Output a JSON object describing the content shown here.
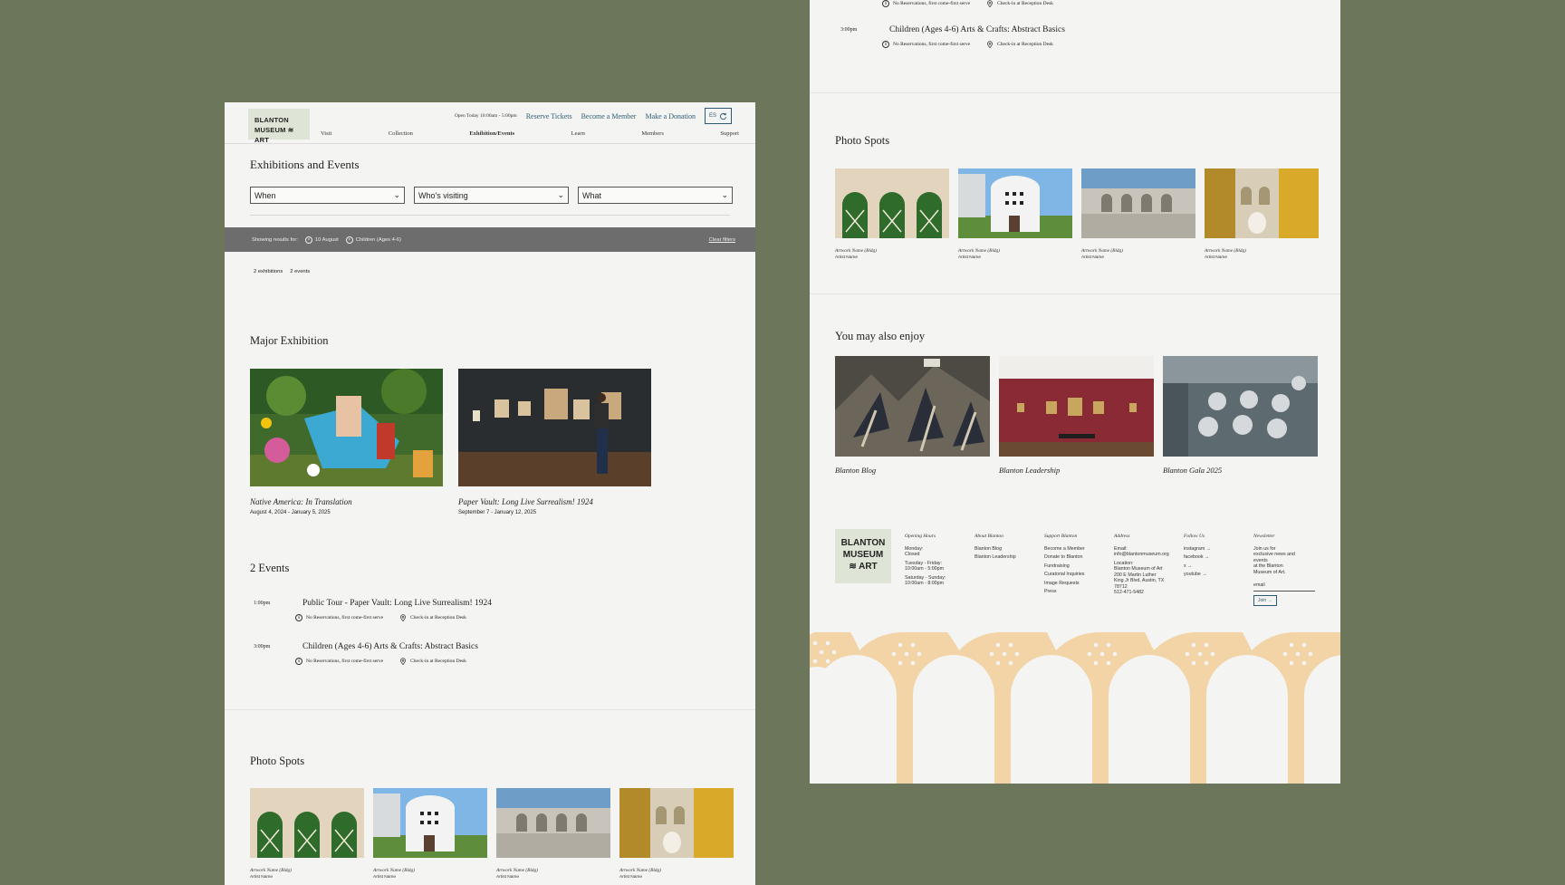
{
  "header": {
    "logo_line1": "BLANTON",
    "logo_line2": "MUSEUM ≋ ART",
    "hours": "Open Today 10:00am - 5:00pm",
    "reserve": "Reserve Tickets",
    "member": "Become a Member",
    "donate": "Make a Donation",
    "lang": "ES"
  },
  "nav": [
    "Visit",
    "Collection",
    "Exhibition/Events",
    "Learn",
    "Members",
    "Support"
  ],
  "page_title": "Exhibitions and Events",
  "filters": {
    "when": "When",
    "who": "Who's visiting",
    "what": "What"
  },
  "results": {
    "label": "Showing results for:",
    "chip1": "10 August",
    "chip2": "Children (Ages 4-6)",
    "clear": "Clear filters",
    "count_exhibitions": "2 exhibitions",
    "count_events": "2 events"
  },
  "major": {
    "title": "Major Exhibition",
    "items": [
      {
        "name": "Native America: In Translation",
        "date": "August 4, 2024 - January 5, 2025"
      },
      {
        "name": "Paper Vault: Long Live Surrealism! 1924",
        "date": "September 7 - January 12, 2025"
      }
    ]
  },
  "events": {
    "title": "2 Events",
    "items": [
      {
        "time": "1:00pm",
        "title": "Public Tour - Paper Vault: Long Live Surrealism! 1924",
        "meta1": "No Reservations, first come-first serve",
        "meta2": "Check-in at Reception Desk"
      },
      {
        "time": "3:00pm",
        "title": "Children (Ages 4-6) Arts & Crafts: Abstract Basics",
        "meta1": "No Reservations, first come-first serve",
        "meta2": "Check-in at Reception Desk"
      }
    ]
  },
  "photo_spots": {
    "title": "Photo Spots",
    "items": [
      {
        "name": "Artwork Name (Bldg)",
        "artist": "Artist Name"
      },
      {
        "name": "Artwork Name (Bldg)",
        "artist": "Artist Name"
      },
      {
        "name": "Artwork Name (Bldg)",
        "artist": "Artist Name"
      },
      {
        "name": "Artwork Name (Bldg)",
        "artist": "Artist Name"
      }
    ]
  },
  "enjoy": {
    "title": "You may also enjoy",
    "items": [
      "Blanton Blog",
      "Blanton Leadership",
      "Blanton Gala 2025"
    ]
  },
  "footer": {
    "logo_line1": "BLANTON",
    "logo_line2": "MUSEUM",
    "logo_line3": "≋ ART",
    "hours": {
      "h": "Opening Hours",
      "l1": "Monday:",
      "l2": "Closed",
      "l3": "Tuesday - Friday:",
      "l4": "10:00am - 5:00pm",
      "l5": "Saturday - Sunday:",
      "l6": "10:00am - 8:00pm"
    },
    "about": {
      "h": "About Blanton",
      "l1": "Blanton Blog",
      "l2": "Blanton Leadership"
    },
    "support": {
      "h": "Support Blanton",
      "l1": "Become a Member",
      "l2": "Donate to Blanton",
      "l3": "Fundraising",
      "l4": "Curatorial Inquiries",
      "l5": "Image Requests",
      "l6": "Press"
    },
    "address": {
      "h": "Address",
      "l1": "Email:",
      "l2": "info@blantonmuseum.org",
      "l3": "Location:",
      "l4": "Blanton Museum of Art",
      "l5": "200 E Martin Luther",
      "l6": "King Jr Blvd, Austin, TX",
      "l7": "78712",
      "l8": "512-471-5482"
    },
    "follow": {
      "h": "Follow Us",
      "l1": "instagram →",
      "l2": "facebook →",
      "l3": "x →",
      "l4": "youtube →"
    },
    "newsletter": {
      "h": "Newsletter",
      "l1": "Join us for",
      "l2": "exclusive news and",
      "l3": "events",
      "l4": "at the Blanton",
      "l5": "Museum of Art.",
      "email": "email",
      "join": "Join →"
    }
  },
  "colors": {
    "background": "#6b765b",
    "panel": "#f4f4f2",
    "accent": "#2b5b74",
    "arch": "#f2d4a6",
    "logo_bg": "#dfe5d6"
  }
}
